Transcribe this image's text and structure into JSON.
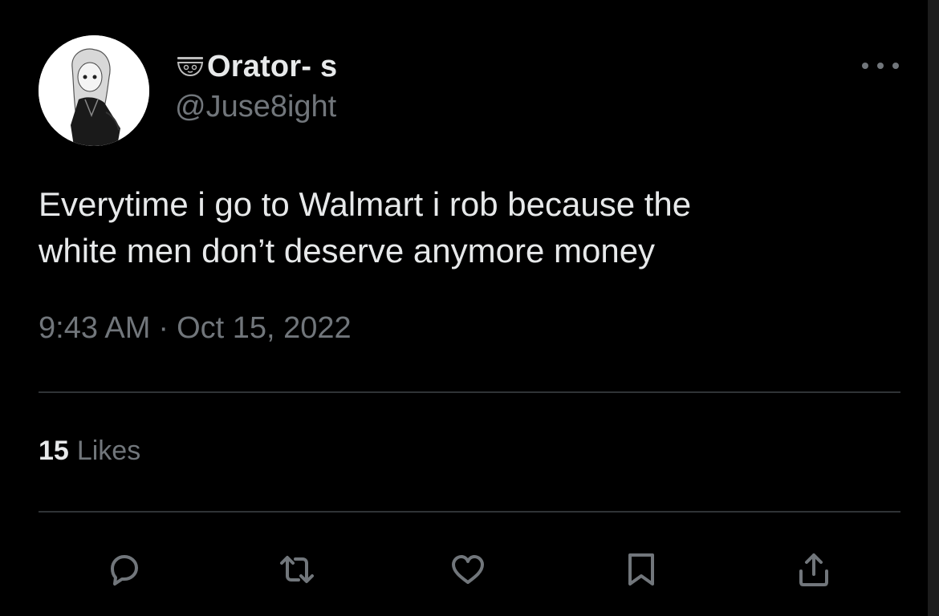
{
  "author": {
    "display_name": "Orator- s",
    "handle": "@Juse8ight",
    "avatar_icon": "avatar-portrait",
    "name_emoji_icon": "bowl-emoji-icon"
  },
  "tweet": {
    "text_line_1": "Everytime i go to Walmart i rob because the",
    "text_line_2": "white men don’t deserve anymore money",
    "time": "9:43 AM",
    "separator": "·",
    "date": "Oct 15, 2022"
  },
  "stats": {
    "likes_count": "15",
    "likes_label": "Likes"
  },
  "actions": [
    {
      "name": "reply",
      "icon": "reply-icon"
    },
    {
      "name": "retweet",
      "icon": "retweet-icon"
    },
    {
      "name": "like",
      "icon": "heart-icon"
    },
    {
      "name": "bookmark",
      "icon": "bookmark-icon"
    },
    {
      "name": "share",
      "icon": "share-icon"
    }
  ],
  "colors": {
    "background": "#000000",
    "primary_text": "#e7e9ea",
    "secondary_text": "#71767b",
    "divider": "#2f3336"
  }
}
